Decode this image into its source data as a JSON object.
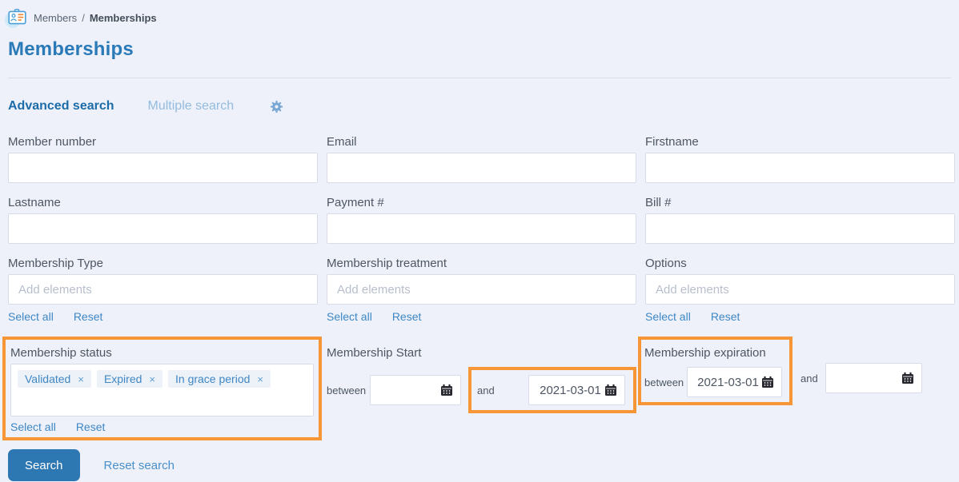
{
  "breadcrumb": {
    "parent": "Members",
    "separator": "/",
    "current": "Memberships"
  },
  "page_title": "Memberships",
  "tabs": {
    "advanced": "Advanced search",
    "multiple": "Multiple search",
    "gear_icon": "gear-icon"
  },
  "fields": {
    "member_number": {
      "label": "Member number",
      "value": ""
    },
    "email": {
      "label": "Email",
      "value": ""
    },
    "firstname": {
      "label": "Firstname",
      "value": ""
    },
    "lastname": {
      "label": "Lastname",
      "value": ""
    },
    "payment": {
      "label": "Payment #",
      "value": ""
    },
    "bill": {
      "label": "Bill #",
      "value": ""
    },
    "membership_type": {
      "label": "Membership Type",
      "value": "",
      "placeholder": "Add elements"
    },
    "membership_treatment": {
      "label": "Membership treatment",
      "value": "",
      "placeholder": "Add elements"
    },
    "options": {
      "label": "Options",
      "value": "",
      "placeholder": "Add elements"
    },
    "membership_status": {
      "label": "Membership status",
      "tags": [
        "Validated",
        "Expired",
        "In grace period"
      ]
    },
    "membership_start": {
      "label": "Membership Start",
      "between_label": "between",
      "and_label": "and",
      "from_value": "",
      "to_value": "2021-03-01"
    },
    "membership_expiration": {
      "label": "Membership expiration",
      "between_label": "between",
      "and_label": "and",
      "from_value": "2021-03-01",
      "to_value": ""
    }
  },
  "links": {
    "select_all": "Select all",
    "reset": "Reset"
  },
  "actions": {
    "search": "Search",
    "reset_search": "Reset search"
  },
  "ui": {
    "remove_glyph": "×",
    "highlight_color": "#f79636",
    "accent_blue": "#2d77b2",
    "link_blue": "#3d87c6",
    "title_blue": "#2a7ab8"
  }
}
